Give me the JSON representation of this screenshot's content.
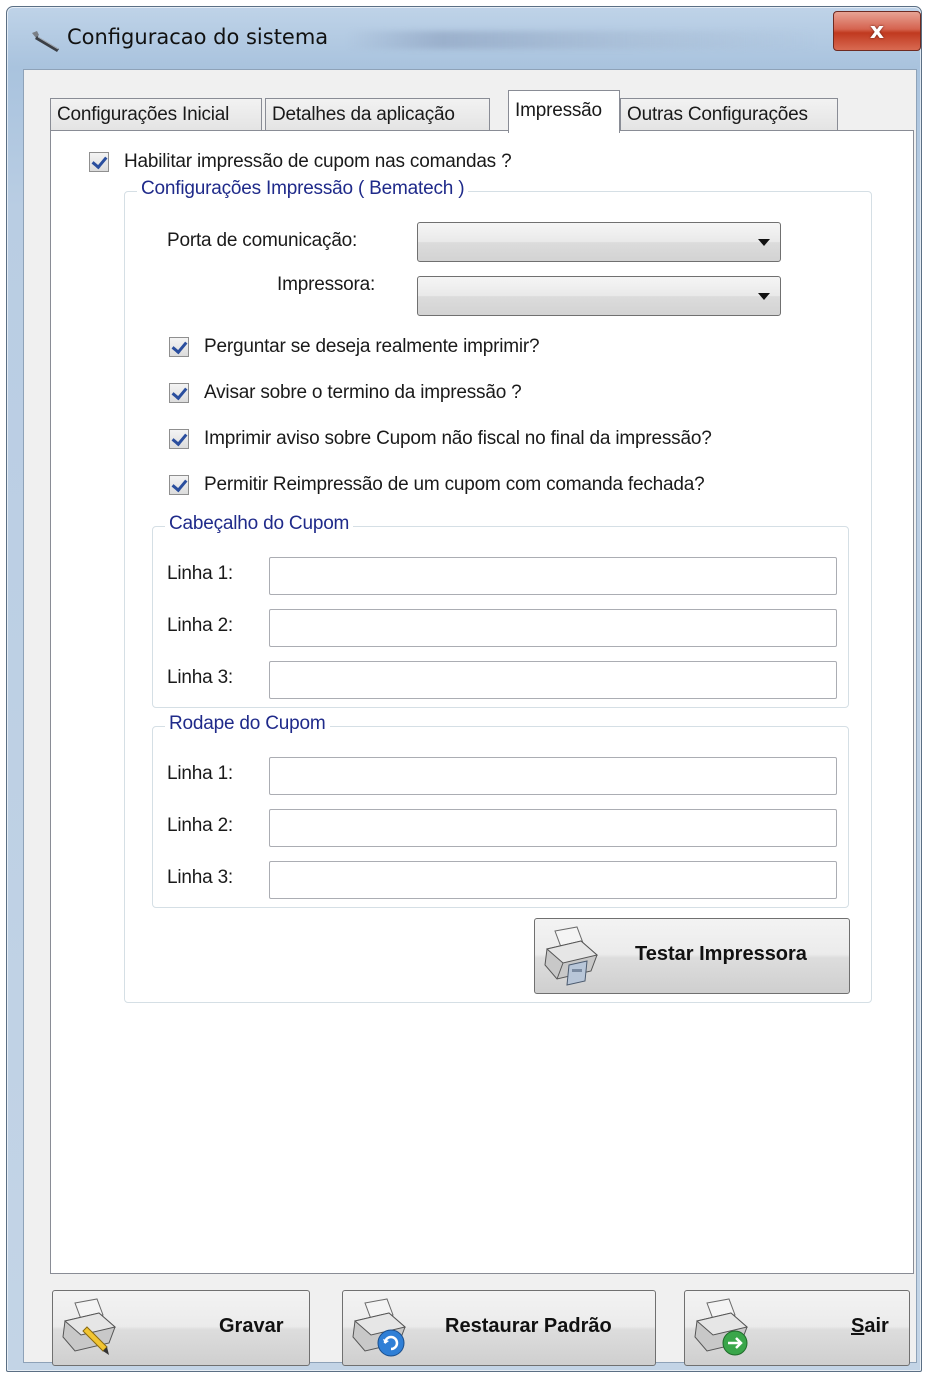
{
  "window": {
    "title": "Configuracao do sistema",
    "close_glyph": "x"
  },
  "tabs": [
    {
      "label": "Configurações Inicial",
      "active": false
    },
    {
      "label": "Detalhes da aplicação",
      "active": false
    },
    {
      "label": "Impressão",
      "active": true
    },
    {
      "label": "Outras Configurações",
      "active": false
    }
  ],
  "print": {
    "enable_label": "Habilitar impressão de cupom nas comandas ?",
    "enable_checked": true,
    "group_title": "Configurações Impressão ( Bematech )",
    "port_label": "Porta de comunicação:",
    "port_value": "",
    "printer_label": "Impressora:",
    "printer_value": "",
    "options": [
      {
        "label": "Perguntar se deseja realmente imprimir?",
        "checked": true
      },
      {
        "label": "Avisar sobre o termino da impressão ?",
        "checked": true
      },
      {
        "label": "Imprimir aviso sobre Cupom não fiscal no final da impressão?",
        "checked": true
      },
      {
        "label": "Permitir Reimpressão de um cupom com comanda fechada?",
        "checked": true
      }
    ],
    "header": {
      "title": "Cabeçalho do Cupom",
      "lines": [
        {
          "label": "Linha 1:",
          "value": ""
        },
        {
          "label": "Linha 2:",
          "value": ""
        },
        {
          "label": "Linha 3:",
          "value": ""
        }
      ]
    },
    "footer": {
      "title": "Rodape do Cupom",
      "lines": [
        {
          "label": "Linha 1:",
          "value": ""
        },
        {
          "label": "Linha 2:",
          "value": ""
        },
        {
          "label": "Linha 3:",
          "value": ""
        }
      ]
    },
    "test_button": "Testar Impressora"
  },
  "footer_buttons": {
    "save": "Gravar",
    "restore": "Restaurar Padrão",
    "exit_mnemonic": "S",
    "exit_rest": "air"
  },
  "icons": {
    "title": "wrench-icon",
    "test": "printer-icon",
    "save": "printer-pencil-icon",
    "restore": "printer-refresh-icon",
    "exit": "printer-exit-icon"
  },
  "colors": {
    "group_title": "#1f2a8a",
    "check_mark": "#2a4e9e",
    "close_button": "#c0391f"
  }
}
